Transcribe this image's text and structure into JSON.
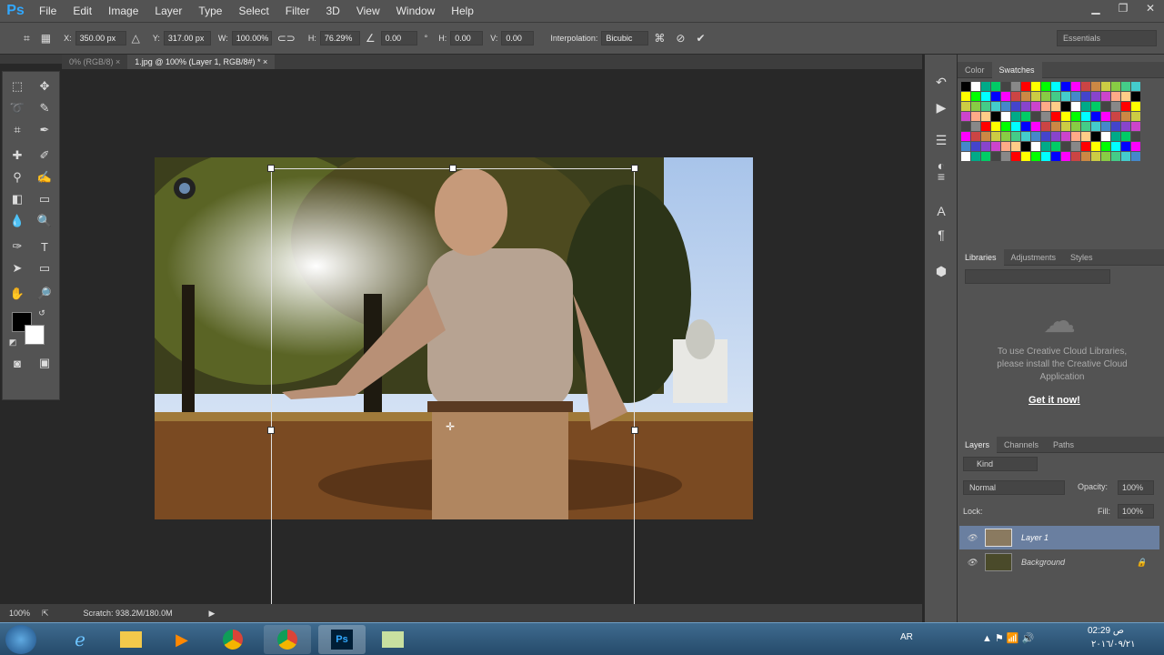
{
  "app": {
    "logo": "Ps"
  },
  "menu": [
    "File",
    "Edit",
    "Image",
    "Layer",
    "Type",
    "Select",
    "Filter",
    "3D",
    "View",
    "Window",
    "Help"
  ],
  "window_controls": {
    "minimize": "▁",
    "restore": "❐",
    "close": "✕"
  },
  "options": {
    "x_label": "X:",
    "x_value": "350.00 px",
    "y_label": "Y:",
    "y_value": "317.00 px",
    "w_label": "W:",
    "w_value": "100.00%",
    "h_label": "H:",
    "h_value": "76.29%",
    "angle_value": "0.00",
    "angle_unit": "°",
    "hskew_label": "H:",
    "hskew_value": "0.00",
    "vskew_label": "V:",
    "vskew_value": "0.00",
    "interp_label": "Interpolation:",
    "interp_value": "Bicubic",
    "workspace": "Essentials"
  },
  "tabs": [
    {
      "label": "0% (RGB/8)"
    },
    {
      "label": "1.jpg @ 100% (Layer 1, RGB/8#) *"
    }
  ],
  "status": {
    "zoom": "100%",
    "scratch": "Scratch: 938.2M/180.0M"
  },
  "color_panel": {
    "tabs": [
      "Color",
      "Swatches"
    ]
  },
  "libraries": {
    "tabs": [
      "Libraries",
      "Adjustments",
      "Styles"
    ],
    "message": "To use Creative Cloud Libraries, please install the Creative Cloud Application",
    "cta": "Get it now!"
  },
  "layers": {
    "tabs": [
      "Layers",
      "Channels",
      "Paths"
    ],
    "filter": "Kind",
    "blend": "Normal",
    "opacity_label": "Opacity:",
    "opacity": "100%",
    "lock_label": "Lock:",
    "fill_label": "Fill:",
    "fill": "100%",
    "items": [
      {
        "name": "Layer 1"
      },
      {
        "name": "Background"
      }
    ]
  },
  "taskbar": {
    "lang": "AR",
    "time": "02:29 ص",
    "date": "٢٠١٦/٠٩/٢١"
  },
  "colors": {
    "chrome": "#535353",
    "canvas": "#282828",
    "selection": "#6a7fa0",
    "accent": "#31a8ff"
  }
}
